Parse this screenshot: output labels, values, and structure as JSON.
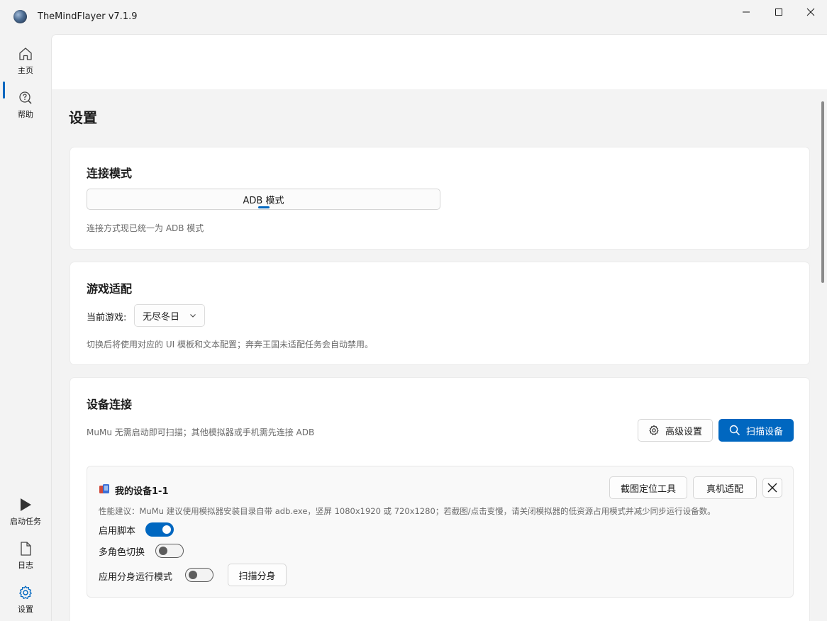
{
  "window": {
    "title": "TheMindFlayer v7.1.9"
  },
  "nav": {
    "top": [
      {
        "label": "主页",
        "icon": "home-icon"
      },
      {
        "label": "帮助",
        "icon": "help-icon"
      }
    ],
    "bottom": [
      {
        "label": "启动任务",
        "icon": "play-icon"
      },
      {
        "label": "日志",
        "icon": "document-icon"
      },
      {
        "label": "设置",
        "icon": "gear-icon"
      }
    ]
  },
  "page": {
    "title": "设置"
  },
  "connection": {
    "title": "连接模式",
    "mode": "ADB 模式",
    "hint": "连接方式现已统一为 ADB 模式"
  },
  "game": {
    "title": "游戏适配",
    "current_label": "当前游戏:",
    "current_value": "无尽冬日",
    "hint": "切换后将使用对应的 UI 模板和文本配置；奔奔王国未适配任务会自动禁用。"
  },
  "devices": {
    "title": "设备连接",
    "hint": "MuMu 无需启动即可扫描；其他模拟器或手机需先连接 ADB",
    "advanced_label": "高级设置",
    "scan_label": "扫描设备",
    "item": {
      "name": "我的设备1-1",
      "screenshot_tool_label": "截图定位工具",
      "real_device_label": "真机适配",
      "perf_hint": "性能建议：MuMu 建议使用模拟器安装目录自带 adb.exe，竖屏 1080x1920 或 720x1280；若截图/点击变慢，请关闭模拟器的低资源占用模式并减少同步运行设备数。",
      "enable_script_label": "启用脚本",
      "enable_script_on": true,
      "multi_role_label": "多角色切换",
      "multi_role_on": false,
      "clone_mode_label": "应用分身运行模式",
      "clone_mode_on": false,
      "scan_clone_label": "扫描分身"
    }
  },
  "colors": {
    "accent": "#0067c0"
  }
}
